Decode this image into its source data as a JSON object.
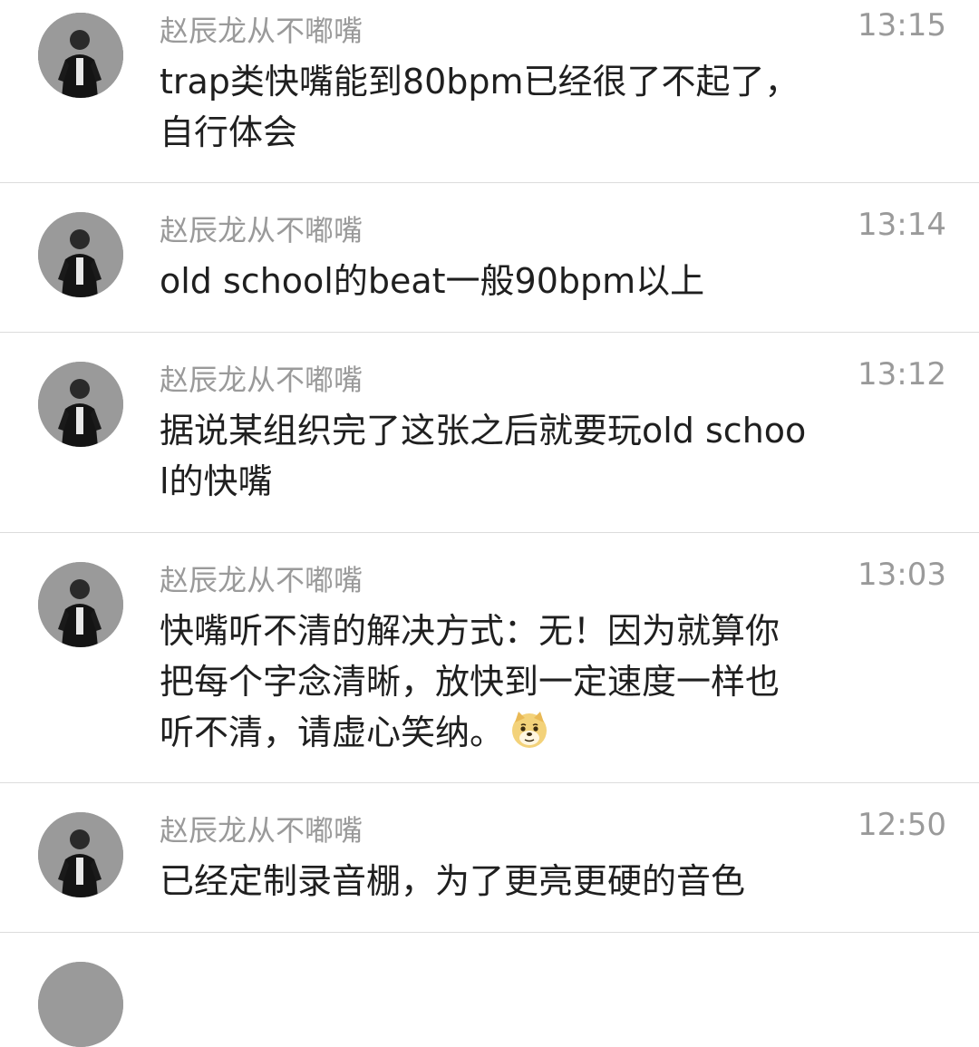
{
  "comments": [
    {
      "author": "赵辰龙从不嘟嘴",
      "time": "13:15",
      "text": "trap类快嘴能到80bpm已经很了不起了，自行体会",
      "emoji": ""
    },
    {
      "author": "赵辰龙从不嘟嘴",
      "time": "13:14",
      "text": "old school的beat一般90bpm以上",
      "emoji": ""
    },
    {
      "author": "赵辰龙从不嘟嘴",
      "time": "13:12",
      "text": "据说某组织完了这张之后就要玩old school的快嘴",
      "emoji": ""
    },
    {
      "author": "赵辰龙从不嘟嘴",
      "time": "13:03",
      "text": "快嘴听不清的解决方式：无！因为就算你把每个字念清晰，放快到一定速度一样也听不清，请虚心笑纳。",
      "emoji": "doge-emoji"
    },
    {
      "author": "赵辰龙从不嘟嘴",
      "time": "12:50",
      "text": "已经定制录音棚，为了更亮更硬的音色",
      "emoji": ""
    }
  ]
}
